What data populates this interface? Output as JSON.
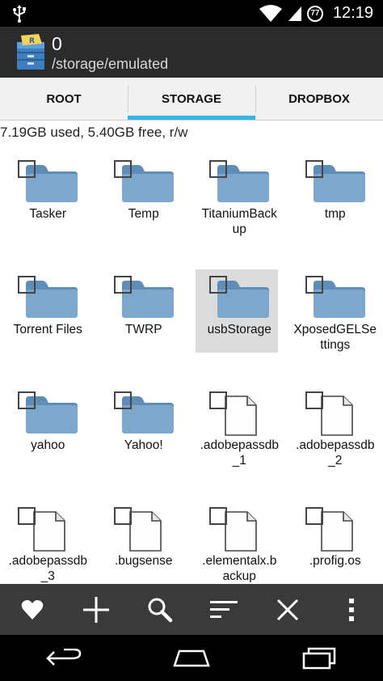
{
  "status_bar": {
    "time": "12:19",
    "battery": "77"
  },
  "action_bar": {
    "title": "0",
    "subtitle": "/storage/emulated"
  },
  "tabs": [
    {
      "label": "ROOT",
      "active": false
    },
    {
      "label": "STORAGE",
      "active": true
    },
    {
      "label": "DROPBOX",
      "active": false
    }
  ],
  "usage_text": "7.19GB used, 5.40GB free, r/w",
  "items": [
    {
      "name": "Tasker",
      "type": "folder"
    },
    {
      "name": "Temp",
      "type": "folder"
    },
    {
      "name": "TitaniumBack\nup",
      "type": "folder"
    },
    {
      "name": "tmp",
      "type": "folder"
    },
    {
      "name": "Torrent Files",
      "type": "folder"
    },
    {
      "name": "TWRP",
      "type": "folder"
    },
    {
      "name": "usbStorage",
      "type": "folder",
      "selected": true
    },
    {
      "name": "XposedGELSe\nttings",
      "type": "folder"
    },
    {
      "name": "yahoo",
      "type": "folder"
    },
    {
      "name": "Yahoo!",
      "type": "folder"
    },
    {
      "name": ".adobepassdb\n_1",
      "type": "file"
    },
    {
      "name": ".adobepassdb\n_2",
      "type": "file"
    },
    {
      "name": ".adobepassdb\n_3",
      "type": "file"
    },
    {
      "name": ".bugsense",
      "type": "file"
    },
    {
      "name": ".elementalx.b\nackup",
      "type": "file"
    },
    {
      "name": ".profig.os",
      "type": "file"
    }
  ],
  "toolbar": [
    "favorites-icon",
    "add-icon",
    "search-icon",
    "sort-icon",
    "close-icon",
    "overflow-menu-icon"
  ],
  "nav": [
    "back-icon",
    "home-icon",
    "recents-icon"
  ],
  "colors": {
    "accent": "#33b5e5",
    "folder": "#7da7cc",
    "action_bar": "#2b2b2b",
    "toolbar": "#3a3a3a"
  }
}
